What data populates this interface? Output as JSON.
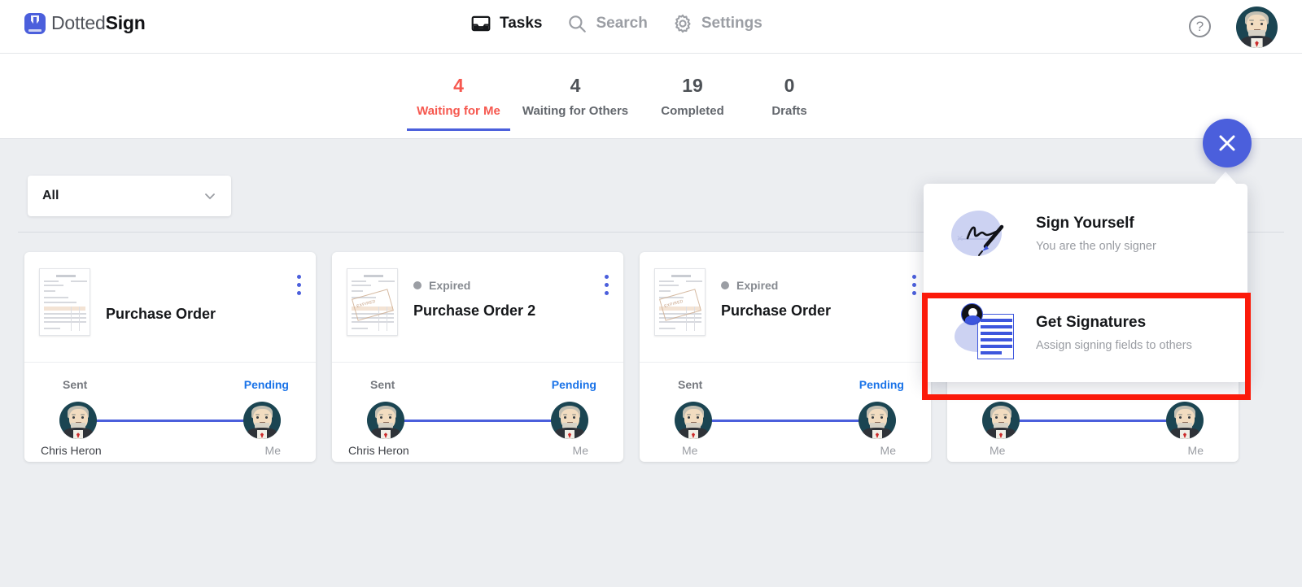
{
  "brand": {
    "name_thin": "Dotted",
    "name_bold": "Sign",
    "logo_icon": "dottedsign-logo-icon"
  },
  "nav": {
    "items": [
      {
        "label": "Tasks",
        "icon": "inbox-icon",
        "active": true
      },
      {
        "label": "Search",
        "icon": "search-icon",
        "active": false
      },
      {
        "label": "Settings",
        "icon": "gear-icon",
        "active": false
      }
    ],
    "help_icon": "question-mark-icon",
    "avatar_icon": "user-avatar"
  },
  "tabs": [
    {
      "count": "4",
      "label": "Waiting for Me",
      "active": true
    },
    {
      "count": "4",
      "label": "Waiting for Others",
      "active": false
    },
    {
      "count": "19",
      "label": "Completed",
      "active": false
    },
    {
      "count": "0",
      "label": "Drafts",
      "active": false
    }
  ],
  "filter": {
    "value": "All",
    "chevron_icon": "chevron-down-icon"
  },
  "cards": [
    {
      "title": "Purchase Order",
      "badge": null,
      "thumbnail_icon": "document-thumbnail",
      "menu_icon": "kebab-menu-icon",
      "left_status": "Sent",
      "right_status": "Pending",
      "left_name": "Chris Heron",
      "right_name": "Me",
      "left_name_muted": false
    },
    {
      "title": "Purchase Order 2",
      "badge": "Expired",
      "thumbnail_icon": "document-thumbnail",
      "menu_icon": "kebab-menu-icon",
      "left_status": "Sent",
      "right_status": "Pending",
      "left_name": "Chris Heron",
      "right_name": "Me",
      "left_name_muted": false
    },
    {
      "title": "Purchase Order",
      "badge": "Expired",
      "thumbnail_icon": "document-thumbnail",
      "menu_icon": "kebab-menu-icon",
      "left_status": "Sent",
      "right_status": "Pending",
      "left_name": "Me",
      "right_name": "Me",
      "left_name_muted": true
    },
    {
      "title": "",
      "badge": null,
      "thumbnail_icon": "document-thumbnail",
      "menu_icon": "kebab-menu-icon",
      "left_status": "",
      "right_status": "",
      "left_name": "Me",
      "right_name": "Me",
      "left_name_muted": true
    }
  ],
  "fab": {
    "icon": "close-x-icon",
    "color": "#4b5fdc"
  },
  "popup": {
    "items": [
      {
        "title": "Sign Yourself",
        "subtitle": "You are the only signer",
        "icon": "signature-pen-icon",
        "highlighted": false
      },
      {
        "title": "Get Signatures",
        "subtitle": "Assign signing fields to others",
        "icon": "document-assign-icon",
        "highlighted": true
      }
    ],
    "highlight_color": "#fb1a0a"
  },
  "colors": {
    "accent_blue": "#4b5fdc",
    "active_tab_red": "#f6584f",
    "pending_blue": "#1a73e8",
    "page_bg": "#eceef1"
  }
}
